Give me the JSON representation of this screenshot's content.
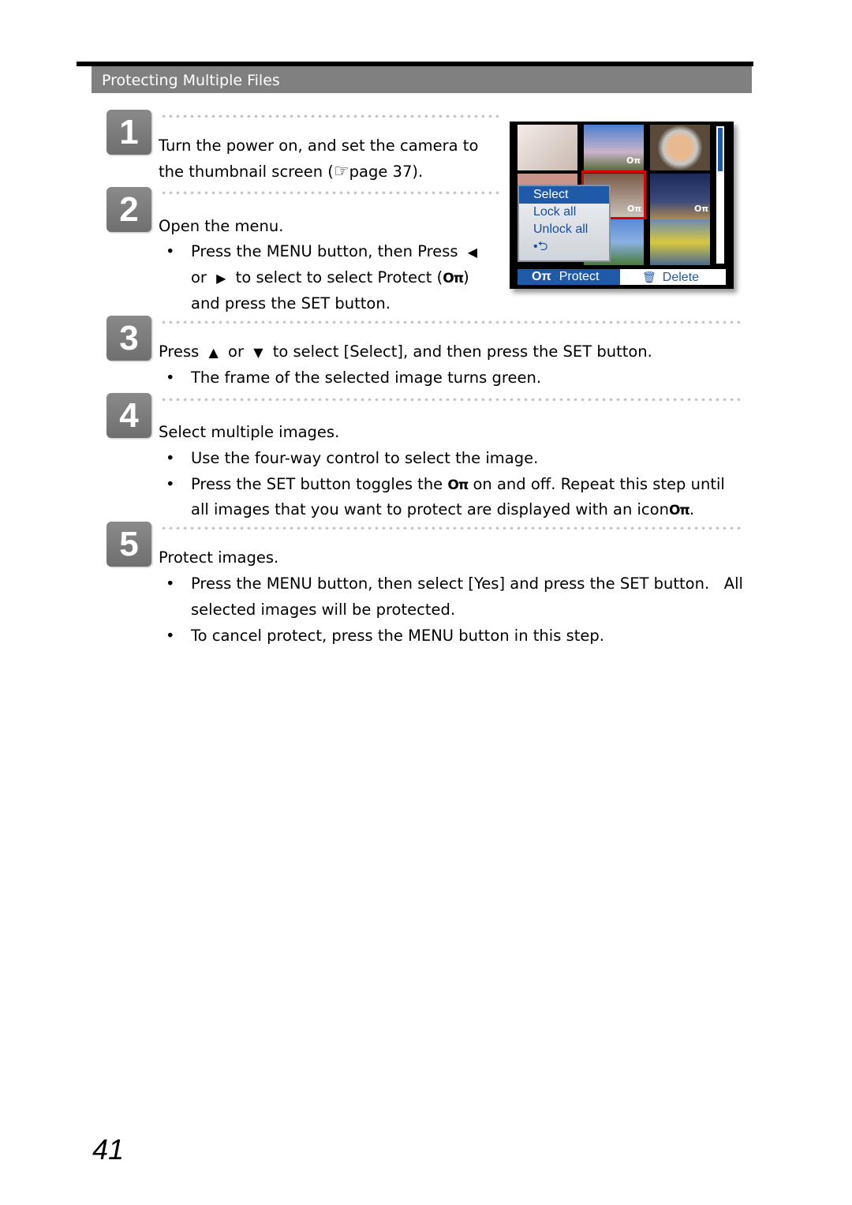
{
  "section_title": "Protecting Multiple Files",
  "page_number": "41",
  "steps": [
    {
      "number": "1",
      "title_line1": "Turn the power on, and set the camera to",
      "title_line2_a": "the thumbnail screen (",
      "title_line2_icon": "pointing-hand-icon",
      "title_line2_b": "page 37)."
    },
    {
      "number": "2",
      "title": "Open the menu.",
      "bullet_line1_a": "Press the ",
      "bullet_line1_b": "MENU",
      "bullet_line1_c": " button, then Press ",
      "bullet_line2_a": "or ",
      "bullet_line2_b": " to select to select ",
      "bullet_line2_c": "Protect",
      "bullet_line2_d": " (",
      "bullet_line2_e": ")",
      "bullet_line3_a": "and press the ",
      "bullet_line3_b": "SET",
      "bullet_line3_c": " button."
    },
    {
      "number": "3",
      "title_a": "Press ",
      "title_b": " or ",
      "title_c": " to select [Select], and then press the SET button.",
      "bullet": "The frame of the selected image turns green."
    },
    {
      "number": "4",
      "title": "Select multiple images.",
      "bullet1": "Use the four-way control to select the image.",
      "bullet2_a": "Press the ",
      "bullet2_b": "SET",
      "bullet2_c": " button toggles the ",
      "bullet2_d": " on and off. Repeat this step until",
      "bullet2_line2_a": "all images that you want to protect are displayed with an icon",
      "bullet2_line2_b": "."
    },
    {
      "number": "5",
      "title": "Protect images.",
      "bullet1_a": "Press the ",
      "bullet1_b": "MENU",
      "bullet1_c": " button, then select ",
      "bullet1_d": "[Yes]",
      "bullet1_e": " and press the ",
      "bullet1_f": "SET",
      "bullet1_g": " button.   All",
      "bullet1_line2": "selected images will be protected.",
      "bullet2_a": "To cancel protect, press the ",
      "bullet2_b": "MENU",
      "bullet2_c": " button in this step."
    }
  ],
  "glyphs": {
    "bullet": "•",
    "left_arrow": "◀",
    "right_arrow": "▶",
    "up_arrow": "▲",
    "down_arrow": "▼",
    "key": "Oπ",
    "hand": "☞",
    "trash": "🗑"
  },
  "camera_screen": {
    "menu_items": [
      "Select",
      "Lock all",
      "Unlock all",
      "•⮌"
    ],
    "selected_menu_item": "Select",
    "bottom_bar": {
      "protect_label": "Protect",
      "delete_label": "Delete"
    },
    "colors": {
      "highlight": "#1e5aa8",
      "selection_frame": "#dd0000"
    }
  }
}
